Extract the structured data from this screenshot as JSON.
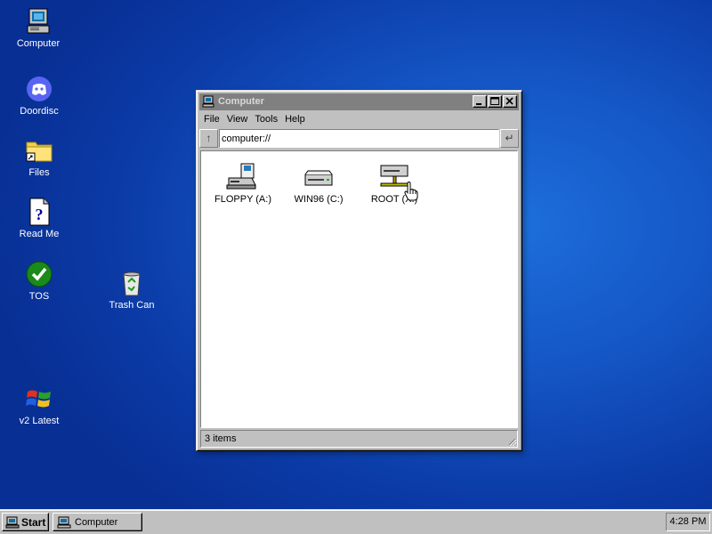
{
  "desktop": {
    "icons": [
      {
        "label": "Computer",
        "icon": "computer-icon"
      },
      {
        "label": "Doordisc",
        "icon": "discord-icon"
      },
      {
        "label": "Files",
        "icon": "folder-shortcut-icon"
      },
      {
        "label": "Read Me",
        "icon": "help-document-icon"
      },
      {
        "label": "TOS",
        "icon": "checkmark-icon"
      },
      {
        "label": "Trash Can",
        "icon": "recycle-bin-icon"
      },
      {
        "label": "v2 Latest",
        "icon": "windows-flag-icon"
      }
    ]
  },
  "window": {
    "title": "Computer",
    "menu": [
      "File",
      "View",
      "Tools",
      "Help"
    ],
    "address": "computer://",
    "items": [
      {
        "label": "FLOPPY (A:)",
        "icon": "floppy-drive-icon"
      },
      {
        "label": "WIN96 (C:)",
        "icon": "hard-drive-icon"
      },
      {
        "label": "ROOT (X:)",
        "icon": "network-drive-icon"
      }
    ],
    "status": "3 items"
  },
  "taskbar": {
    "start_label": "Start",
    "tasks": [
      {
        "label": "Computer"
      }
    ],
    "clock": "4:28 PM"
  },
  "colors": {
    "desktop": "#1455c4",
    "window_face": "#c0c0c0",
    "titlebar_inactive": "#808080"
  }
}
